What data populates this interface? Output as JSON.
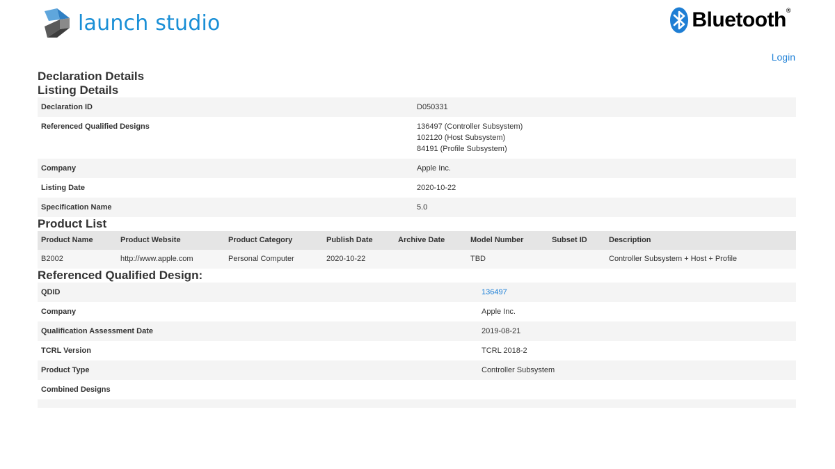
{
  "header": {
    "logo_text": "launch studio",
    "logo_icon": "launch-studio-logo",
    "bluetooth_text": "Bluetooth",
    "bluetooth_reg": "®",
    "login_label": "Login"
  },
  "page": {
    "declaration_title": "Declaration Details",
    "listing_title": "Listing Details",
    "product_list_title": "Product List",
    "rqd_title": "Referenced Qualified Design:"
  },
  "listing": {
    "rows": [
      {
        "key": "Declaration ID",
        "lines": [
          "D050331"
        ]
      },
      {
        "key": "Referenced Qualified Designs",
        "lines": [
          "136497 (Controller Subsystem)",
          "102120 (Host Subsystem)",
          "84191 (Profile Subsystem)"
        ]
      },
      {
        "key": "Company",
        "lines": [
          "Apple Inc."
        ]
      },
      {
        "key": "Listing Date",
        "lines": [
          "2020-10-22"
        ]
      },
      {
        "key": "Specification Name",
        "lines": [
          "5.0"
        ]
      }
    ]
  },
  "product_list": {
    "headers": [
      "Product Name",
      "Product Website",
      "Product Category",
      "Publish Date",
      "Archive Date",
      "Model Number",
      "Subset ID",
      "Description"
    ],
    "rows": [
      [
        "B2002",
        "http://www.apple.com",
        "Personal Computer",
        "2020-10-22",
        "",
        "TBD",
        "",
        "Controller Subsystem + Host + Profile"
      ]
    ]
  },
  "rqd": {
    "rows": [
      {
        "key": "QDID",
        "value": "136497",
        "link": true
      },
      {
        "key": "Company",
        "value": "Apple Inc."
      },
      {
        "key": "Qualification Assessment Date",
        "value": "2019-08-21"
      },
      {
        "key": "TCRL Version",
        "value": "TCRL 2018-2"
      },
      {
        "key": "Product Type",
        "value": "Controller Subsystem"
      },
      {
        "key": "Combined Designs",
        "value": ""
      },
      {
        "key": "",
        "value": ""
      }
    ]
  },
  "colors": {
    "accent": "#1a8fd6",
    "link": "#1a7ed6",
    "row_alt": "#f4f4f4",
    "header_row": "#e5e5e5"
  }
}
